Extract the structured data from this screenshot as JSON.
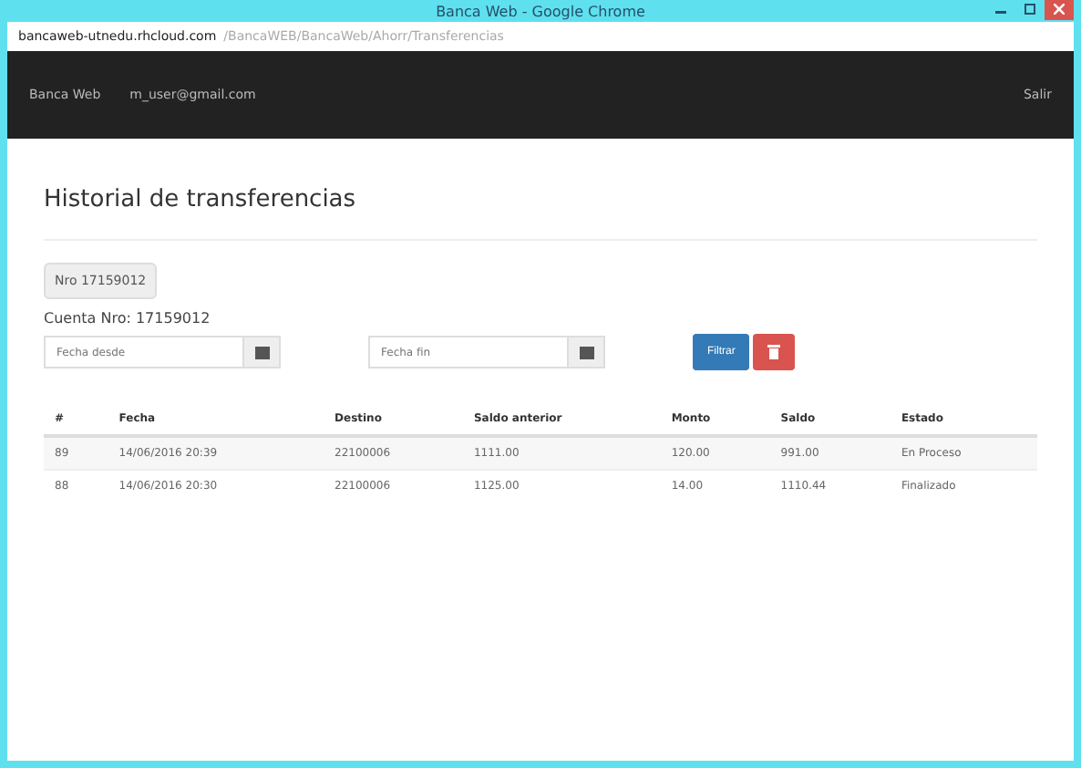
{
  "window": {
    "title": "Banca Web - Google Chrome"
  },
  "address_bar": {
    "host": "bancaweb-utnedu.rhcloud.com",
    "path": "/BancaWEB/BancaWeb/Ahorr/Transferencias"
  },
  "navbar": {
    "brand": "Banca Web",
    "user": "m_user@gmail.com",
    "logout": "Salir"
  },
  "page": {
    "title": "Historial de transferencias",
    "account_badge": "Nro 17159012",
    "account_label": "Cuenta Nro: 17159012"
  },
  "filters": {
    "from": {
      "placeholder": "Fecha desde"
    },
    "to": {
      "placeholder": "Fecha fin"
    },
    "filter_button": "Filtrar"
  },
  "table": {
    "columns": [
      "#",
      "Fecha",
      "Destino",
      "Saldo anterior",
      "Monto",
      "Saldo",
      "Estado"
    ],
    "rows": [
      [
        "89",
        "14/06/2016 20:39",
        "22100006",
        "1111.00",
        "120.00",
        "991.00",
        "En Proceso"
      ],
      [
        "88",
        "14/06/2016 20:30",
        "22100006",
        "1125.00",
        "14.00",
        "1110.44",
        "Finalizado"
      ]
    ]
  }
}
